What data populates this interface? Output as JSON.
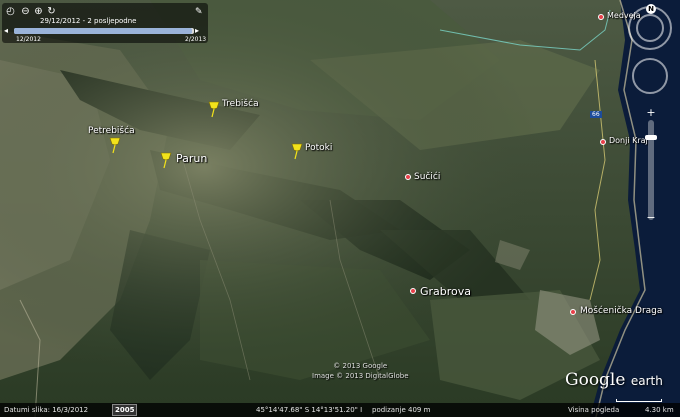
{
  "time_slider": {
    "current_label": "29/12/2012 - 2 posljepodne",
    "start_label": "12/2012",
    "end_label": "2/2013",
    "position_fraction": 0.99
  },
  "places": {
    "trebisca": "Trebišća",
    "petrebisca": "Petrebišća",
    "parun": "Parun",
    "potoki": "Potoki",
    "sucici": "Sučići",
    "grabrova": "Grabrova",
    "medveja": "Medveja",
    "donji_kraj": "Donji Kraj",
    "moscenicka_draga": "Mošćenička Draga"
  },
  "road_shield": "66",
  "map_credit": {
    "line1": "© 2013 Google",
    "line2": "Image © 2013 DigitalGlobe"
  },
  "logo": {
    "brand": "Google",
    "product": "earth"
  },
  "status_bar": {
    "imagery_date": "Datumi slika: 16/3/2012",
    "imagery_year": "2005",
    "coordinates": "45°14'47.68\" S   14°13'51.20\" I",
    "elevation": "podizanje   409 m",
    "eye_altitude": "Visina pogleda",
    "scale": "4.30 km"
  },
  "colors": {
    "pin": "#f2e21b",
    "dot": "#e8404a",
    "sea": "#0b1c3a"
  },
  "icons": [
    "clock-icon",
    "zoom-out-icon",
    "zoom-in-icon",
    "refresh-icon",
    "wrench-icon",
    "compass-icon",
    "look-joystick-icon",
    "move-joystick-icon",
    "zoom-plus-icon",
    "zoom-minus-icon",
    "pin-icon"
  ]
}
